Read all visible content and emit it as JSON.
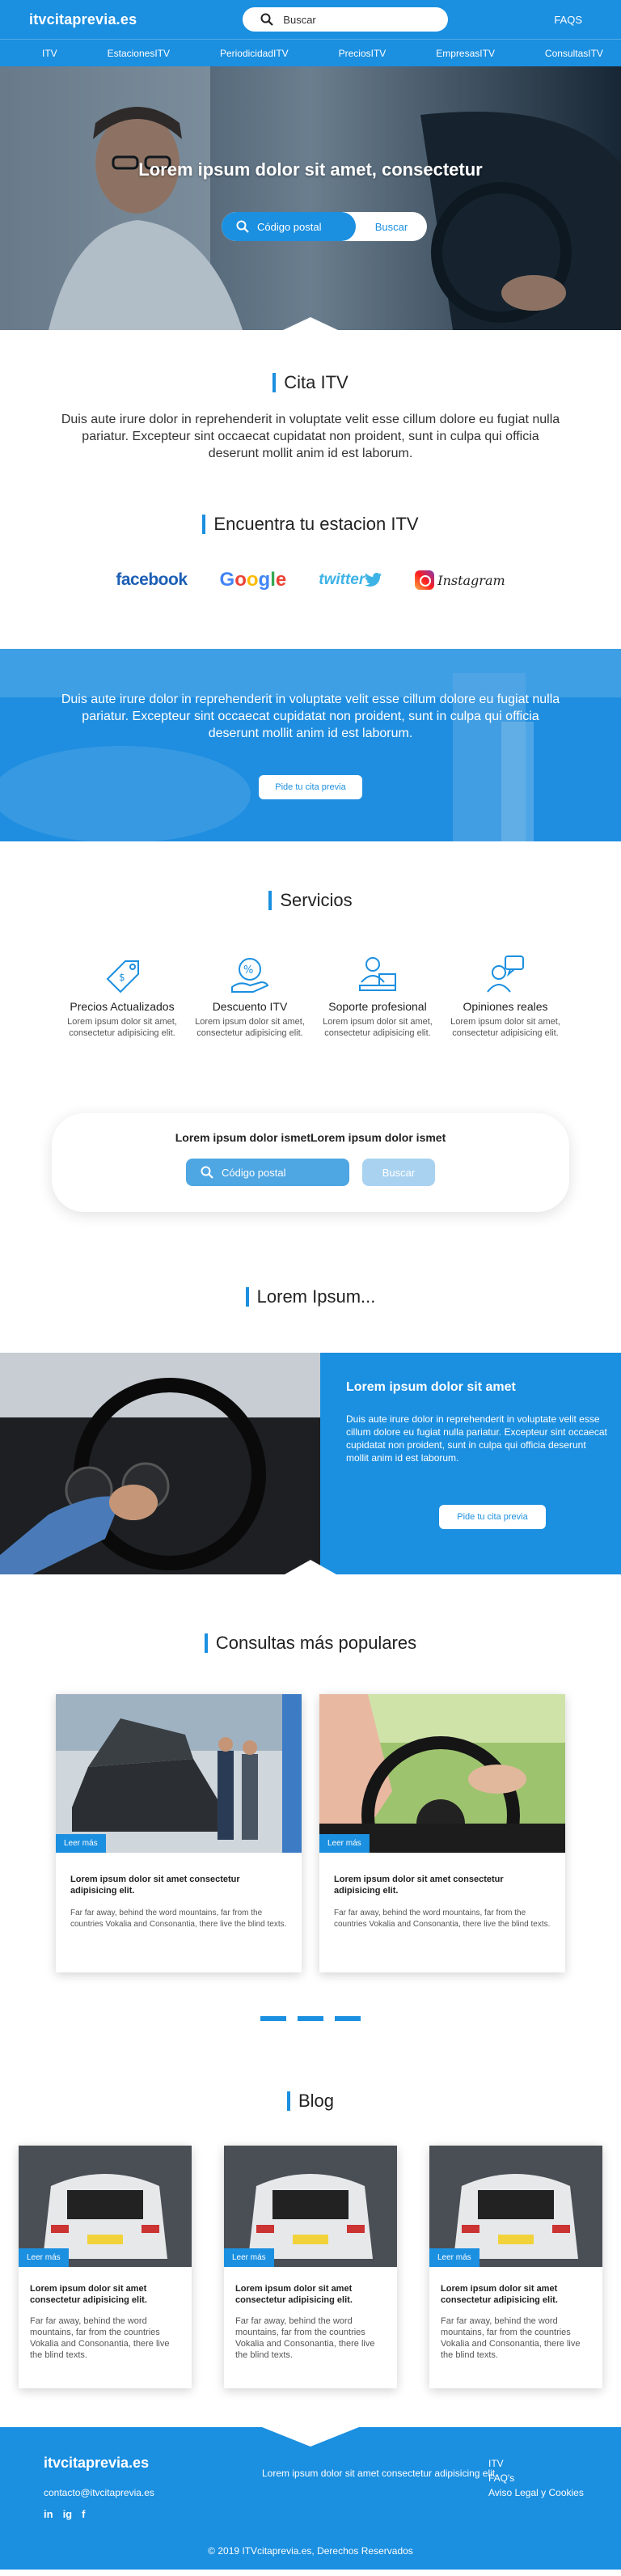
{
  "header": {
    "logo": "itvcitaprevia.es",
    "search_placeholder": "Buscar",
    "faqs": "FAQS"
  },
  "nav": [
    "ITV",
    "EstacionesITV",
    "PeriodicidadITV",
    "PreciosITV",
    "EmpresasITV",
    "ConsultasITV"
  ],
  "hero": {
    "title": "Lorem ipsum dolor sit amet, consectetur",
    "postal_placeholder": "Código postal",
    "search_button": "Buscar"
  },
  "cita": {
    "title": "Cita ITV",
    "text": "Duis aute irure dolor in reprehenderit in voluptate velit esse cillum dolore eu fugiat nulla pariatur. Excepteur sint occaecat cupidatat non proident, sunt in culpa qui officia deserunt mollit anim id est laborum."
  },
  "encuentra": {
    "title": "Encuentra tu estacion ITV",
    "brands": [
      "facebook",
      "Google",
      "twitter",
      "Instagram"
    ]
  },
  "banner": {
    "text": "Duis aute irure dolor in reprehenderit in voluptate velit esse cillum dolore eu fugiat nulla pariatur. Excepteur sint occaecat cupidatat non proident, sunt in culpa qui officia deserunt mollit anim id est laborum.",
    "button": "Pide tu cita previa"
  },
  "servicios": {
    "title": "Servicios",
    "items": [
      {
        "title": "Precios Actualizados",
        "text": "Lorem ipsum dolor sit amet, consectetur adipisicing elit.",
        "icon": "price-tag-icon"
      },
      {
        "title": "Descuento ITV",
        "text": "Lorem ipsum dolor sit amet, consectetur adipisicing elit.",
        "icon": "discount-icon"
      },
      {
        "title": "Soporte profesional",
        "text": "Lorem ipsum dolor sit amet, consectetur adipisicing elit.",
        "icon": "support-icon"
      },
      {
        "title": "Opiniones reales",
        "text": "Lorem ipsum dolor sit amet, consectetur adipisicing elit.",
        "icon": "reviews-icon"
      }
    ]
  },
  "boxsearch": {
    "title": "Lorem ipsum dolor ismetLorem ipsum dolor ismet",
    "postal_placeholder": "Código postal",
    "button": "Buscar"
  },
  "lorem": {
    "title": "Lorem Ipsum...",
    "panel_title": "Lorem ipsum dolor sit amet",
    "panel_text": "Duis aute irure dolor in reprehenderit in voluptate velit esse cillum dolore eu fugiat nulla pariatur. Excepteur sint occaecat cupidatat non proident, sunt in culpa qui officia deserunt mollit anim id est laborum.",
    "button": "Pide tu cita previa"
  },
  "consultas": {
    "title": "Consultas más populares",
    "cards": [
      {
        "tag": "Leer más",
        "title": "Lorem ipsum dolor sit amet consectetur adipisicing elit.",
        "text": "Far far away, behind the word mountains, far from the countries Vokalia and Consonantia, there live the blind texts."
      },
      {
        "tag": "Leer más",
        "title": "Lorem ipsum dolor sit amet consectetur adipisicing elit.",
        "text": "Far far away, behind the word mountains, far from the countries Vokalia and Consonantia, there live the blind texts."
      }
    ]
  },
  "blog": {
    "title": "Blog",
    "cards": [
      {
        "tag": "Leer más",
        "title": "Lorem ipsum dolor sit amet consectetur adipisicing elit.",
        "text": "Far far away, behind the word mountains, far from the countries Vokalia and Consonantia, there live the blind texts."
      },
      {
        "tag": "Leer más",
        "title": "Lorem ipsum dolor sit amet consectetur adipisicing elit.",
        "text": "Far far away, behind the word mountains, far from the countries Vokalia and Consonantia, there live the blind texts."
      },
      {
        "tag": "Leer más",
        "title": "Lorem ipsum dolor sit amet consectetur adipisicing elit.",
        "text": "Far far away, behind the word mountains, far from the countries Vokalia and Consonantia, there live the blind texts."
      }
    ]
  },
  "footer": {
    "logo": "itvcitaprevia.es",
    "email": "contacto@itvcitaprevia.es",
    "social": [
      "in",
      "ig",
      "f"
    ],
    "middle_text": "Lorem ipsum dolor sit amet consectetur adipisicing elit.",
    "links": [
      "ITV",
      "FAQ's",
      "Aviso Legal y Cookies"
    ],
    "copyright": "© 2019 ITVcitaprevia.es, Derechos Reservados"
  },
  "colors": {
    "accent": "#1b8fe0"
  }
}
